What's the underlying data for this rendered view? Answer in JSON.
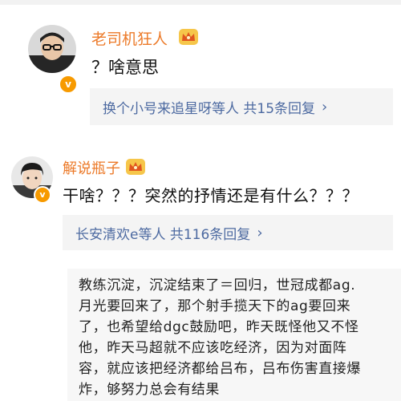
{
  "comments": [
    {
      "username": "老司机狂人",
      "text": "？啥意思",
      "verified_mark": "v",
      "reply_summary": "换个小号来追星呀等人 共15条回复",
      "reply_chevron": "›"
    },
    {
      "username": "解说瓶子",
      "text": "干啥？？？突然的抒情还是有什么？？？",
      "verified_mark": "v",
      "reply_summary": "长安清欢e等人 共116条回复",
      "reply_chevron": "›"
    }
  ],
  "quote": {
    "lines": [
      "教练沉淀，沉淀结束了＝回归，世冠成都ag.",
      "月光要回来了，那个射手揽天下的ag要回来",
      "了，也希望给dgc鼓励吧，昨天既怪他又不怪",
      "他，昨天马超就不应该吃经济，因为对面阵",
      "容，就应该把经济都给吕布，吕布伤害直接爆",
      "炸，够努力总会有结果"
    ]
  },
  "colors": {
    "username": "#ec7a29",
    "reply_link": "#4d6aa1",
    "reply_bg": "#f4f4f4",
    "badge": "#f79a00"
  }
}
